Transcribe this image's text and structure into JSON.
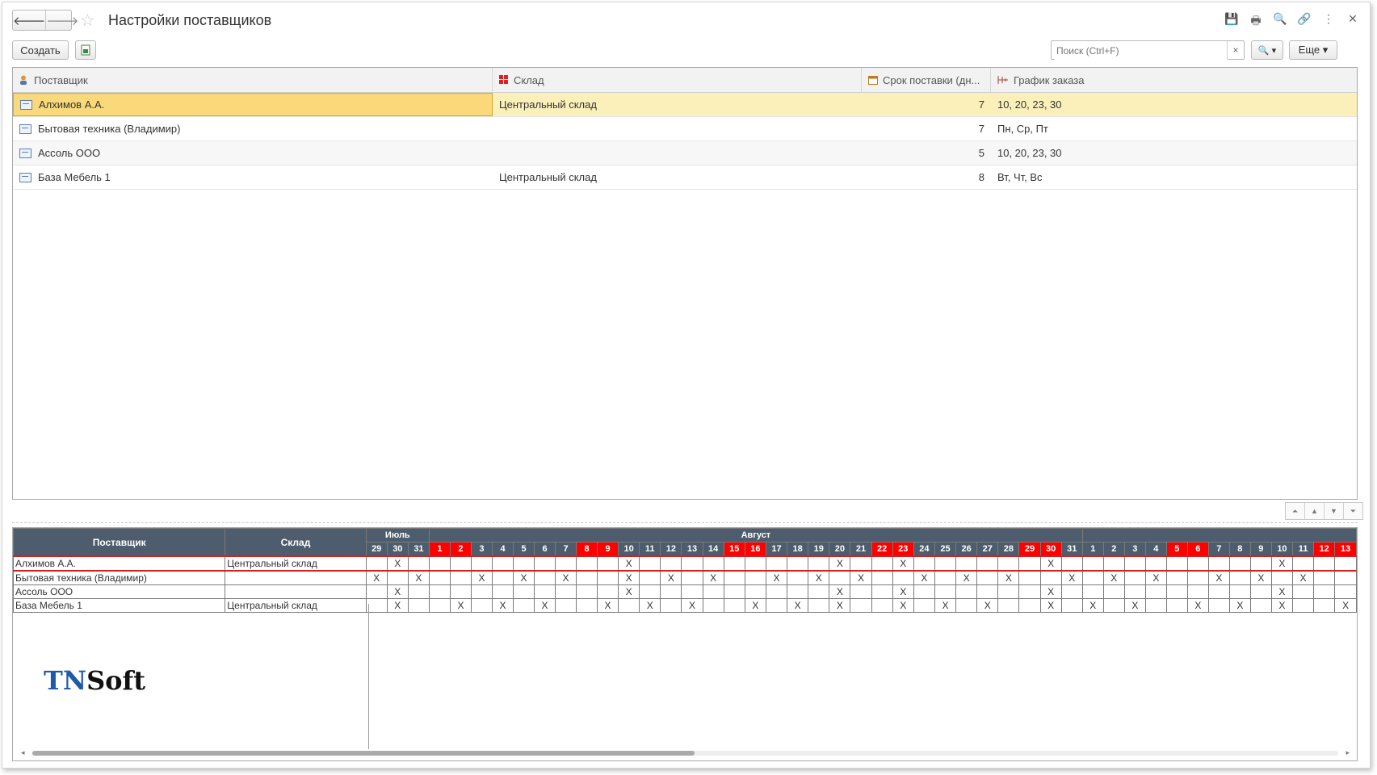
{
  "title": "Настройки поставщиков",
  "nav": {
    "back": "🡐",
    "forward": "🡒"
  },
  "window_tools": [
    "💾",
    "🖶",
    "🔍",
    "🔗",
    "⋮",
    "✕"
  ],
  "toolbar": {
    "create_label": "Создать",
    "search_placeholder": "Поиск (Ctrl+F)",
    "search_clear": "×",
    "search_btn": "🔍 ▾",
    "more_label": "Еще ▾"
  },
  "list": {
    "headers": [
      "Поставщик",
      "Склад",
      "Срок поставки (дн...",
      "График заказа"
    ],
    "rows": [
      {
        "supplier": "Алхимов А.А.",
        "warehouse": "Центральный склад",
        "days": "7",
        "schedule": "10, 20, 23, 30"
      },
      {
        "supplier": "Бытовая техника (Владимир)",
        "warehouse": "",
        "days": "7",
        "schedule": "Пн, Ср, Пт"
      },
      {
        "supplier": "Ассоль ООО",
        "warehouse": "",
        "days": "5",
        "schedule": "10, 20, 23, 30"
      },
      {
        "supplier": "База Мебель 1",
        "warehouse": "Центральный склад",
        "days": "8",
        "schedule": "Вт, Чт, Вс"
      }
    ]
  },
  "split_buttons": [
    "⏶",
    "▲",
    "▼",
    "⏷"
  ],
  "schedule": {
    "col_supplier": "Поставщик",
    "col_warehouse": "Склад",
    "months": [
      {
        "label": "Июль",
        "span": 3
      },
      {
        "label": "Август",
        "span": 31
      },
      {
        "label": "",
        "span": 13
      }
    ],
    "days": [
      "29",
      "30",
      "31",
      "1",
      "2",
      "3",
      "4",
      "5",
      "6",
      "7",
      "8",
      "9",
      "10",
      "11",
      "12",
      "13",
      "14",
      "15",
      "16",
      "17",
      "18",
      "19",
      "20",
      "21",
      "22",
      "23",
      "24",
      "25",
      "26",
      "27",
      "28",
      "29",
      "30",
      "31",
      "1",
      "2",
      "3",
      "4",
      "5",
      "6",
      "7",
      "8",
      "9",
      "10",
      "11",
      "12",
      "13"
    ],
    "weekend": [
      0,
      0,
      0,
      1,
      1,
      0,
      0,
      0,
      0,
      0,
      1,
      1,
      0,
      0,
      0,
      0,
      0,
      1,
      1,
      0,
      0,
      0,
      0,
      0,
      1,
      1,
      0,
      0,
      0,
      0,
      0,
      1,
      1,
      0,
      0,
      0,
      0,
      0,
      1,
      1,
      0,
      0,
      0,
      0,
      0,
      1,
      1
    ],
    "rows": [
      {
        "supplier": "Алхимов А.А.",
        "warehouse": "Центральный склад",
        "marks": [
          0,
          1,
          0,
          0,
          0,
          0,
          0,
          0,
          0,
          0,
          0,
          0,
          1,
          0,
          0,
          0,
          0,
          0,
          0,
          0,
          0,
          0,
          1,
          0,
          0,
          1,
          0,
          0,
          0,
          0,
          0,
          0,
          1,
          0,
          0,
          0,
          0,
          0,
          0,
          0,
          0,
          0,
          0,
          1,
          0,
          0,
          0
        ]
      },
      {
        "supplier": "Бытовая техника (Владимир)",
        "warehouse": "",
        "marks": [
          1,
          0,
          1,
          0,
          0,
          1,
          0,
          1,
          0,
          1,
          0,
          0,
          1,
          0,
          1,
          0,
          1,
          0,
          0,
          1,
          0,
          1,
          0,
          1,
          0,
          0,
          1,
          0,
          1,
          0,
          1,
          0,
          0,
          1,
          0,
          1,
          0,
          1,
          0,
          0,
          1,
          0,
          1,
          0,
          1,
          0,
          0
        ]
      },
      {
        "supplier": "Ассоль ООО",
        "warehouse": "",
        "marks": [
          0,
          1,
          0,
          0,
          0,
          0,
          0,
          0,
          0,
          0,
          0,
          0,
          1,
          0,
          0,
          0,
          0,
          0,
          0,
          0,
          0,
          0,
          1,
          0,
          0,
          1,
          0,
          0,
          0,
          0,
          0,
          0,
          1,
          0,
          0,
          0,
          0,
          0,
          0,
          0,
          0,
          0,
          0,
          1,
          0,
          0,
          0
        ]
      },
      {
        "supplier": "База Мебель 1",
        "warehouse": "Центральный склад",
        "marks": [
          0,
          1,
          0,
          0,
          1,
          0,
          1,
          0,
          1,
          0,
          0,
          1,
          0,
          1,
          0,
          1,
          0,
          0,
          1,
          0,
          1,
          0,
          1,
          0,
          0,
          1,
          0,
          1,
          0,
          1,
          0,
          0,
          1,
          0,
          1,
          0,
          1,
          0,
          0,
          1,
          0,
          1,
          0,
          1,
          0,
          0,
          1
        ]
      }
    ],
    "mark_char": "X"
  },
  "logo": {
    "part1": "TN",
    "part2": "Soft"
  },
  "colors": {
    "selection": "#fbefba",
    "header_dark": "#4d5d6d",
    "weekend": "#ff0000"
  }
}
